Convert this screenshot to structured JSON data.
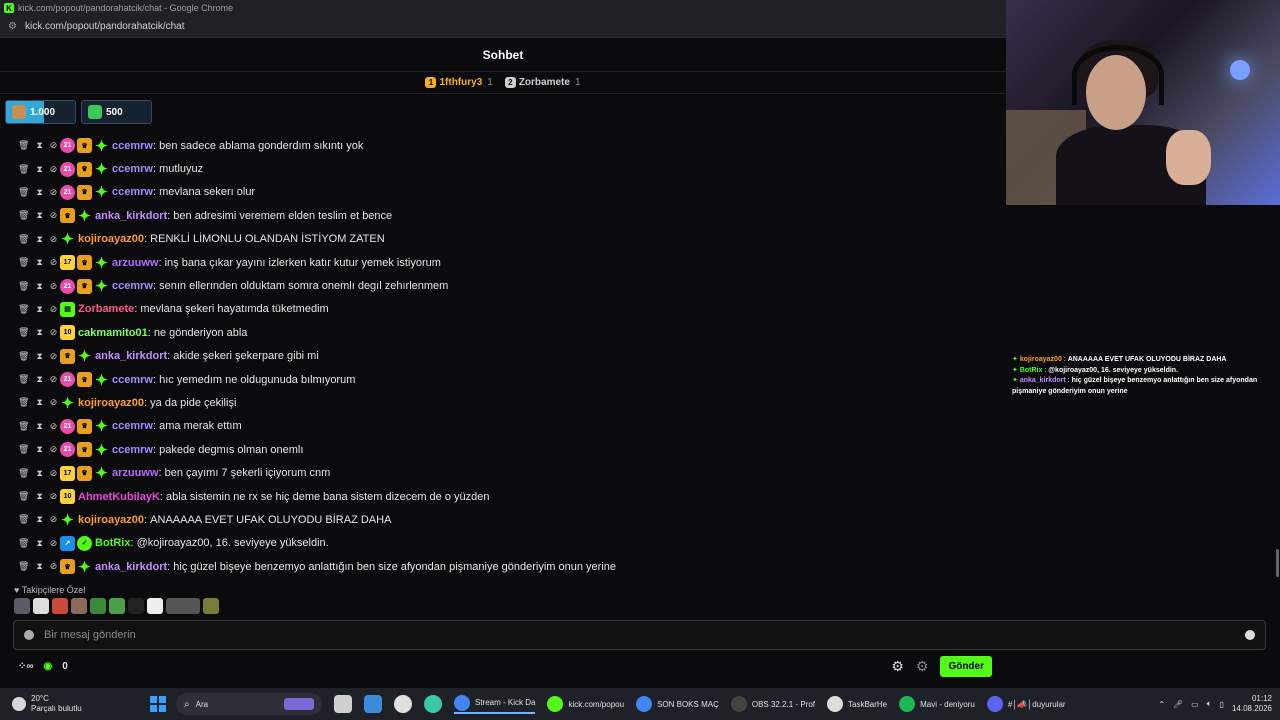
{
  "browser": {
    "title": "kick.com/popout/pandorahatcik/chat - Google Chrome",
    "url": "kick.com/popout/pandorahatcik/chat"
  },
  "chat": {
    "header": "Sohbet",
    "leaderboard": [
      {
        "rank": "1",
        "name": "1fthfury3",
        "count": "1",
        "color": "#f5b316"
      },
      {
        "rank": "2",
        "name": "Zorbamete",
        "count": "1",
        "color": "#cfcfcf"
      }
    ],
    "goals": [
      {
        "value": "1.000",
        "progress": 0.55
      },
      {
        "value": "500",
        "progress": 0.0
      }
    ],
    "messages": [
      {
        "badges": [
          "sub21",
          "crown",
          "star"
        ],
        "user": "ccemrw",
        "color": "#a58bff",
        "text": "ben sadece ablama gonderdım sıkıntı yok"
      },
      {
        "badges": [
          "sub21",
          "crown",
          "star"
        ],
        "user": "ccemrw",
        "color": "#a58bff",
        "text": "mutluyuz"
      },
      {
        "badges": [
          "sub21",
          "crown",
          "star"
        ],
        "user": "ccemrw",
        "color": "#a58bff",
        "text": "mevlana sekerı olur"
      },
      {
        "badges": [
          "crown",
          "star"
        ],
        "user": "anka_kirkdort",
        "color": "#c58cff",
        "text": "ben adresimi veremem elden teslim et bence"
      },
      {
        "badges": [
          "star"
        ],
        "user": "kojiroayaz00",
        "color": "#ff9d2e",
        "text": "RENKLİ LİMONLU OLANDAN İSTİYOM ZATEN"
      },
      {
        "badges": [
          "sub17",
          "crown",
          "star"
        ],
        "user": "arzuuww",
        "color": "#b56bff",
        "text": "inş bana çıkar yayını izlerken katır kutur yemek istiyorum"
      },
      {
        "badges": [
          "sub21",
          "crown",
          "star"
        ],
        "user": "ccemrw",
        "color": "#a58bff",
        "text": "senın ellerınden olduktam somra onemlı degıl zehırlenmem"
      },
      {
        "badges": [
          "green"
        ],
        "user": "Zorbamete",
        "color": "#ff5a8a",
        "text": "mevlana şekeri hayatımda tüketmedim"
      },
      {
        "badges": [
          "sub10"
        ],
        "user": "cakmamito01",
        "color": "#7dff5a",
        "text": "ne gönderiyon abla"
      },
      {
        "badges": [
          "crown",
          "star"
        ],
        "user": "anka_kirkdort",
        "color": "#c58cff",
        "text": "akide şekeri şekerpare gibi mi"
      },
      {
        "badges": [
          "sub21",
          "crown",
          "star"
        ],
        "user": "ccemrw",
        "color": "#a58bff",
        "text": "hıc yemedım ne oldugunuda bılmıyorum"
      },
      {
        "badges": [
          "star"
        ],
        "user": "kojiroayaz00",
        "color": "#ff9d2e",
        "text": "ya da pide çekilişi"
      },
      {
        "badges": [
          "sub21",
          "crown",
          "star"
        ],
        "user": "ccemrw",
        "color": "#a58bff",
        "text": "ama merak ettım"
      },
      {
        "badges": [
          "sub21",
          "crown",
          "star"
        ],
        "user": "ccemrw",
        "color": "#a58bff",
        "text": "pakede degmıs olman onemlı"
      },
      {
        "badges": [
          "sub17",
          "crown",
          "star"
        ],
        "user": "arzuuww",
        "color": "#b56bff",
        "text": "ben çayımı 7 şekerli içiyorum cnm"
      },
      {
        "badges": [
          "sub10"
        ],
        "user": "AhmetKubilayK",
        "color": "#e84ad8",
        "text": "abla sistemin ne rx se hiç deme bana sistem dizecem de o yüzden"
      },
      {
        "badges": [
          "star"
        ],
        "user": "kojiroayaz00",
        "color": "#ff9d2e",
        "text": "ANAAAAA EVET UFAK OLUYODU BİRAZ DAHA"
      },
      {
        "badges": [
          "blue",
          "verified"
        ],
        "user": "BotRix",
        "color": "#53fc18",
        "text": "@kojiroayaz00, 16. seviyeye yükseldin."
      },
      {
        "badges": [
          "crown",
          "star"
        ],
        "user": "anka_kirkdort",
        "color": "#c58cff",
        "text": "hiç güzel bişeye benzemyo anlattığın ben size afyondan pişmaniye gönderiyim onun yerine"
      }
    ],
    "followers_label": "Takipçilere Özel",
    "input_placeholder": "Bir mesaj gönderin",
    "points": "0",
    "send_label": "Gönder"
  },
  "overlay": [
    {
      "user": "kojiroayaz00",
      "color": "#ff9d2e",
      "text": "ANAAAAA EVET UFAK OLUYODU BİRAZ DAHA"
    },
    {
      "user": "BotRix",
      "color": "#53fc18",
      "text": "@kojiroayaz00, 16. seviyeye yükseldin."
    },
    {
      "user": "anka_kirkdort",
      "color": "#c58cff",
      "text": "hiç güzel bişeye benzemyo anlattığın ben size afyondan pişmaniye gönderiyim onun yerine"
    }
  ],
  "taskbar": {
    "temperature": "20°C",
    "weather": "Parçalı bulutlu",
    "search": "Ara",
    "apps": [
      {
        "label": "Stream - Kick Da",
        "color": "#4285f4",
        "active": true
      },
      {
        "label": "kick.com/popou",
        "color": "#53fc18",
        "active": false
      },
      {
        "label": "SON BOKS MAÇ",
        "color": "#4285f4",
        "active": false
      },
      {
        "label": "OBS 32.2.1 - Prof",
        "color": "#444444",
        "active": false
      },
      {
        "label": "TaskBarHe",
        "color": "#dddddd",
        "active": false
      },
      {
        "label": "Mavi - deniyoru",
        "color": "#1db954",
        "active": false
      },
      {
        "label": "#│📣│duyurular",
        "color": "#5865f2",
        "active": false
      }
    ],
    "time": "01:12",
    "date": "14.08.2026"
  }
}
